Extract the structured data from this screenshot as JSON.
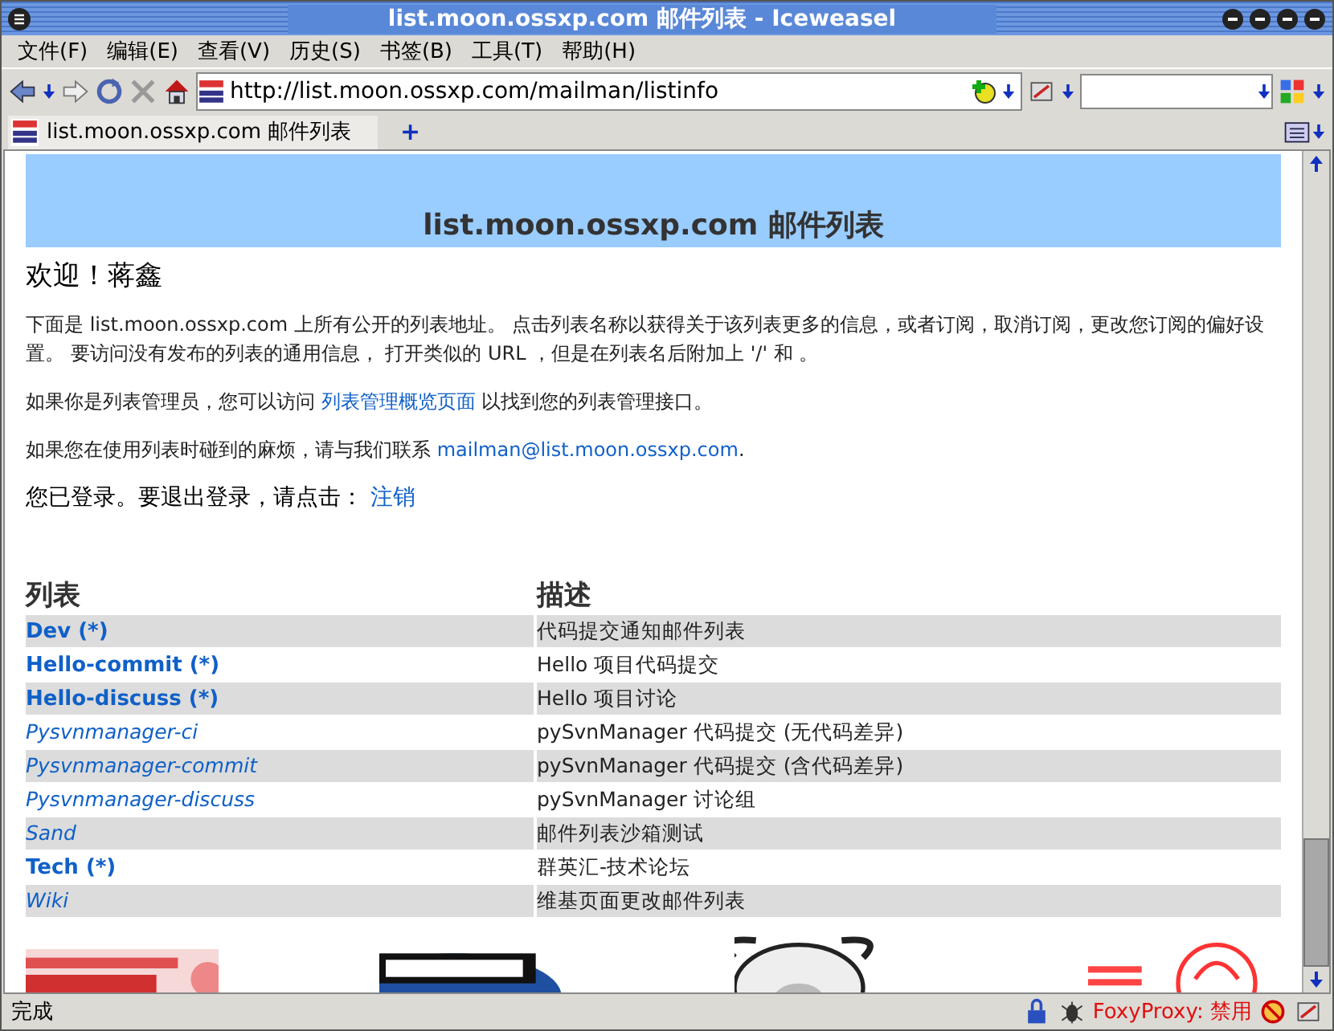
{
  "window": {
    "title": "list.moon.ossxp.com 邮件列表 - Iceweasel"
  },
  "menu": [
    "文件(F)",
    "编辑(E)",
    "查看(V)",
    "历史(S)",
    "书签(B)",
    "工具(T)",
    "帮助(H)"
  ],
  "address": {
    "value": "http://list.moon.ossxp.com/mailman/listinfo"
  },
  "tabs": [
    {
      "label": "list.moon.ossxp.com 邮件列表",
      "selected": true
    }
  ],
  "new_tab": "+",
  "page": {
    "heading": "list.moon.ossxp.com 邮件列表",
    "welcome": "欢迎！蒋鑫",
    "intro": "下面是 list.moon.ossxp.com 上所有公开的列表地址。 点击列表名称以获得关于该列表更多的信息，或者订阅，取消订阅，更改您订阅的偏好设置。 要访问没有发布的列表的通用信息， 打开类似的 URL ，但是在列表名后附加上 '/' 和 。",
    "admin_before": "如果你是列表管理员，您可以访问 ",
    "admin_link": "列表管理概览页面",
    "admin_after": " 以找到您的列表管理接口。",
    "contact_before": "如果您在使用列表时碰到的麻烦，请与我们联系 ",
    "contact_link": "mailman@list.moon.ossxp.com",
    "contact_after": ".",
    "logged_in": "您已登录。要退出登录，请点击： ",
    "logout_link": "注销",
    "columns": [
      "列表",
      "描述"
    ],
    "rows": [
      {
        "name": "Dev (*)",
        "bold": true,
        "description": "代码提交通知邮件列表"
      },
      {
        "name": "Hello-commit (*)",
        "bold": true,
        "description": "Hello 项目代码提交"
      },
      {
        "name": "Hello-discuss (*)",
        "bold": true,
        "description": "Hello 项目讨论"
      },
      {
        "name": "Pysvnmanager-ci",
        "bold": false,
        "description": "pySvnManager 代码提交 (无代码差异)"
      },
      {
        "name": "Pysvnmanager-commit",
        "bold": false,
        "description": "pySvnManager 代码提交 (含代码差异)"
      },
      {
        "name": "Pysvnmanager-discuss",
        "bold": false,
        "description": "pySvnManager 讨论组"
      },
      {
        "name": "Sand",
        "bold": false,
        "description": "邮件列表沙箱测试"
      },
      {
        "name": "Tech (*)",
        "bold": true,
        "description": "群英汇-技术论坛"
      },
      {
        "name": "Wiki",
        "bold": false,
        "description": "维基页面更改邮件列表"
      }
    ]
  },
  "status_bar": {
    "text": "完成",
    "proxy": "FoxyProxy: 禁用"
  }
}
